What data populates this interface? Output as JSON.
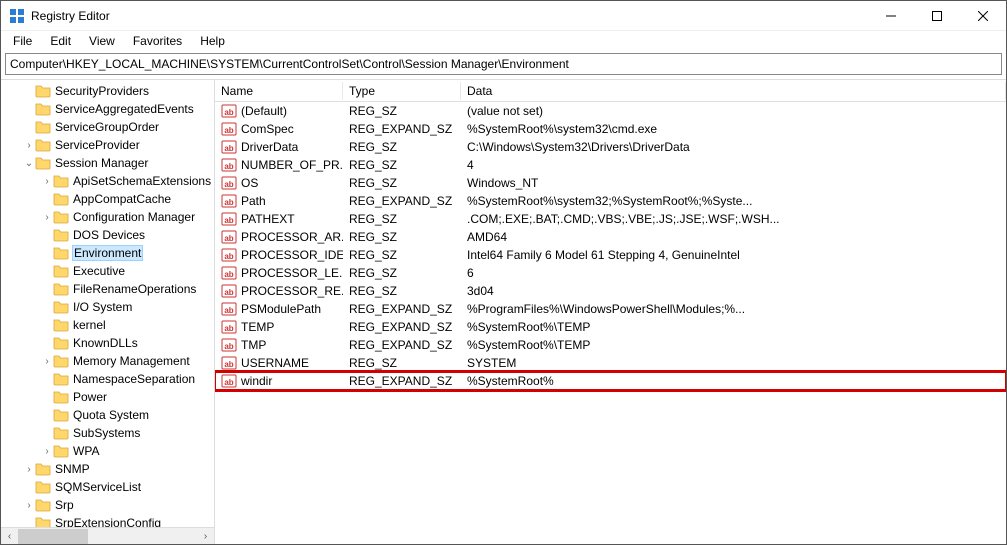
{
  "window": {
    "title": "Registry Editor"
  },
  "menu": {
    "file": "File",
    "edit": "Edit",
    "view": "View",
    "favorites": "Favorites",
    "help": "Help"
  },
  "address": "Computer\\HKEY_LOCAL_MACHINE\\SYSTEM\\CurrentControlSet\\Control\\Session Manager\\Environment",
  "columns": {
    "name": "Name",
    "type": "Type",
    "data": "Data"
  },
  "tree": {
    "items": [
      {
        "label": "SecurityProviders",
        "indent": 1,
        "exp": "",
        "selected": false
      },
      {
        "label": "ServiceAggregatedEvents",
        "indent": 1,
        "exp": "",
        "selected": false
      },
      {
        "label": "ServiceGroupOrder",
        "indent": 1,
        "exp": "",
        "selected": false
      },
      {
        "label": "ServiceProvider",
        "indent": 1,
        "exp": ">",
        "selected": false
      },
      {
        "label": "Session Manager",
        "indent": 1,
        "exp": "v",
        "selected": false
      },
      {
        "label": "ApiSetSchemaExtensions",
        "indent": 2,
        "exp": ">",
        "selected": false
      },
      {
        "label": "AppCompatCache",
        "indent": 2,
        "exp": "",
        "selected": false
      },
      {
        "label": "Configuration Manager",
        "indent": 2,
        "exp": ">",
        "selected": false
      },
      {
        "label": "DOS Devices",
        "indent": 2,
        "exp": "",
        "selected": false
      },
      {
        "label": "Environment",
        "indent": 2,
        "exp": "",
        "selected": true
      },
      {
        "label": "Executive",
        "indent": 2,
        "exp": "",
        "selected": false
      },
      {
        "label": "FileRenameOperations",
        "indent": 2,
        "exp": "",
        "selected": false
      },
      {
        "label": "I/O System",
        "indent": 2,
        "exp": "",
        "selected": false
      },
      {
        "label": "kernel",
        "indent": 2,
        "exp": "",
        "selected": false
      },
      {
        "label": "KnownDLLs",
        "indent": 2,
        "exp": "",
        "selected": false
      },
      {
        "label": "Memory Management",
        "indent": 2,
        "exp": ">",
        "selected": false
      },
      {
        "label": "NamespaceSeparation",
        "indent": 2,
        "exp": "",
        "selected": false
      },
      {
        "label": "Power",
        "indent": 2,
        "exp": "",
        "selected": false
      },
      {
        "label": "Quota System",
        "indent": 2,
        "exp": "",
        "selected": false
      },
      {
        "label": "SubSystems",
        "indent": 2,
        "exp": "",
        "selected": false
      },
      {
        "label": "WPA",
        "indent": 2,
        "exp": ">",
        "selected": false
      },
      {
        "label": "SNMP",
        "indent": 1,
        "exp": ">",
        "selected": false
      },
      {
        "label": "SQMServiceList",
        "indent": 1,
        "exp": "",
        "selected": false
      },
      {
        "label": "Srp",
        "indent": 1,
        "exp": ">",
        "selected": false
      },
      {
        "label": "SrpExtensionConfig",
        "indent": 1,
        "exp": "",
        "selected": false
      }
    ]
  },
  "values": [
    {
      "name": "(Default)",
      "type": "REG_SZ",
      "data": "(value not set)",
      "hl": false
    },
    {
      "name": "ComSpec",
      "type": "REG_EXPAND_SZ",
      "data": "%SystemRoot%\\system32\\cmd.exe",
      "hl": false
    },
    {
      "name": "DriverData",
      "type": "REG_SZ",
      "data": "C:\\Windows\\System32\\Drivers\\DriverData",
      "hl": false
    },
    {
      "name": "NUMBER_OF_PR...",
      "type": "REG_SZ",
      "data": "4",
      "hl": false
    },
    {
      "name": "OS",
      "type": "REG_SZ",
      "data": "Windows_NT",
      "hl": false
    },
    {
      "name": "Path",
      "type": "REG_EXPAND_SZ",
      "data": "%SystemRoot%\\system32;%SystemRoot%;%Syste...",
      "hl": false
    },
    {
      "name": "PATHEXT",
      "type": "REG_SZ",
      "data": ".COM;.EXE;.BAT;.CMD;.VBS;.VBE;.JS;.JSE;.WSF;.WSH...",
      "hl": false
    },
    {
      "name": "PROCESSOR_AR...",
      "type": "REG_SZ",
      "data": "AMD64",
      "hl": false
    },
    {
      "name": "PROCESSOR_IDE...",
      "type": "REG_SZ",
      "data": "Intel64 Family 6 Model 61 Stepping 4, GenuineIntel",
      "hl": false
    },
    {
      "name": "PROCESSOR_LE...",
      "type": "REG_SZ",
      "data": "6",
      "hl": false
    },
    {
      "name": "PROCESSOR_RE...",
      "type": "REG_SZ",
      "data": "3d04",
      "hl": false
    },
    {
      "name": "PSModulePath",
      "type": "REG_EXPAND_SZ",
      "data": "%ProgramFiles%\\WindowsPowerShell\\Modules;%...",
      "hl": false
    },
    {
      "name": "TEMP",
      "type": "REG_EXPAND_SZ",
      "data": "%SystemRoot%\\TEMP",
      "hl": false
    },
    {
      "name": "TMP",
      "type": "REG_EXPAND_SZ",
      "data": "%SystemRoot%\\TEMP",
      "hl": false
    },
    {
      "name": "USERNAME",
      "type": "REG_SZ",
      "data": "SYSTEM",
      "hl": false
    },
    {
      "name": "windir",
      "type": "REG_EXPAND_SZ",
      "data": "%SystemRoot%",
      "hl": true
    }
  ],
  "icons": {
    "app": "regedit-icon",
    "folder": "folder-icon",
    "string_value": "string-value-icon"
  }
}
